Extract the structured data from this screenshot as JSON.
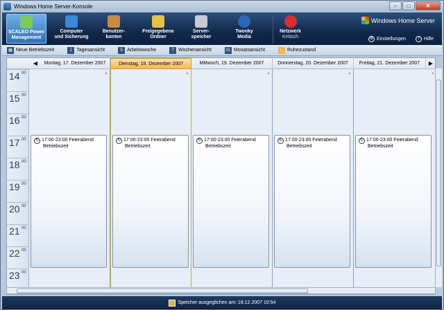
{
  "window": {
    "title": "Windows Home Server-Konsole"
  },
  "toolbar": {
    "items": [
      {
        "line1": "SCALEO Power",
        "line2": "Management",
        "active": true,
        "color": "#7acb5a"
      },
      {
        "line1": "Computer",
        "line2": "und Sicherung",
        "color": "#3a8ad7"
      },
      {
        "line1": "Benutzer-",
        "line2": "konten",
        "color": "#c78b42"
      },
      {
        "line1": "Freigegebene",
        "line2": "Ordner",
        "color": "#e6c049"
      },
      {
        "line1": "Server-",
        "line2": "speicher",
        "color": "#c7ccd3"
      },
      {
        "line1": "Twonky",
        "line2": "Media",
        "color": "#2b66b8"
      }
    ],
    "network": {
      "label": "Netzwerk",
      "status": "Kritisch",
      "color": "#d82e2e"
    },
    "brand": "Windows Home Server",
    "settings_label": "Einstellungen",
    "help_label": "Hilfe"
  },
  "commands": [
    {
      "label": "Neue Betriebszeit",
      "icon": "new-icon"
    },
    {
      "label": "Tagesansicht",
      "icon": "1"
    },
    {
      "label": "Arbeitswoche",
      "icon": "5"
    },
    {
      "label": "Wochenansicht",
      "icon": "7"
    },
    {
      "label": "Monatsansicht",
      "icon": "31"
    },
    {
      "label": "Ruhezustand",
      "icon": "moon-icon"
    }
  ],
  "days": [
    {
      "label": "Montag, 17. Dezember 2007",
      "today": false
    },
    {
      "label": "Dienstag, 18. Dezember 2007",
      "today": true
    },
    {
      "label": "Mittwoch, 19. Dezember 2007",
      "today": false
    },
    {
      "label": "Donnerstag, 20. Dezember 2007",
      "today": false
    },
    {
      "label": "Freitag, 21. Dezember 2007",
      "today": false
    }
  ],
  "hours": [
    "14",
    "15",
    "16",
    "17",
    "18",
    "19",
    "20",
    "21",
    "22",
    "23"
  ],
  "minutes": "00",
  "event": {
    "title": "17:00-23:00 Feierabend",
    "subtitle": "Betriebszeit"
  },
  "status": {
    "text": "Speicher ausgeglichen am: 18.12.2007 10:54"
  }
}
